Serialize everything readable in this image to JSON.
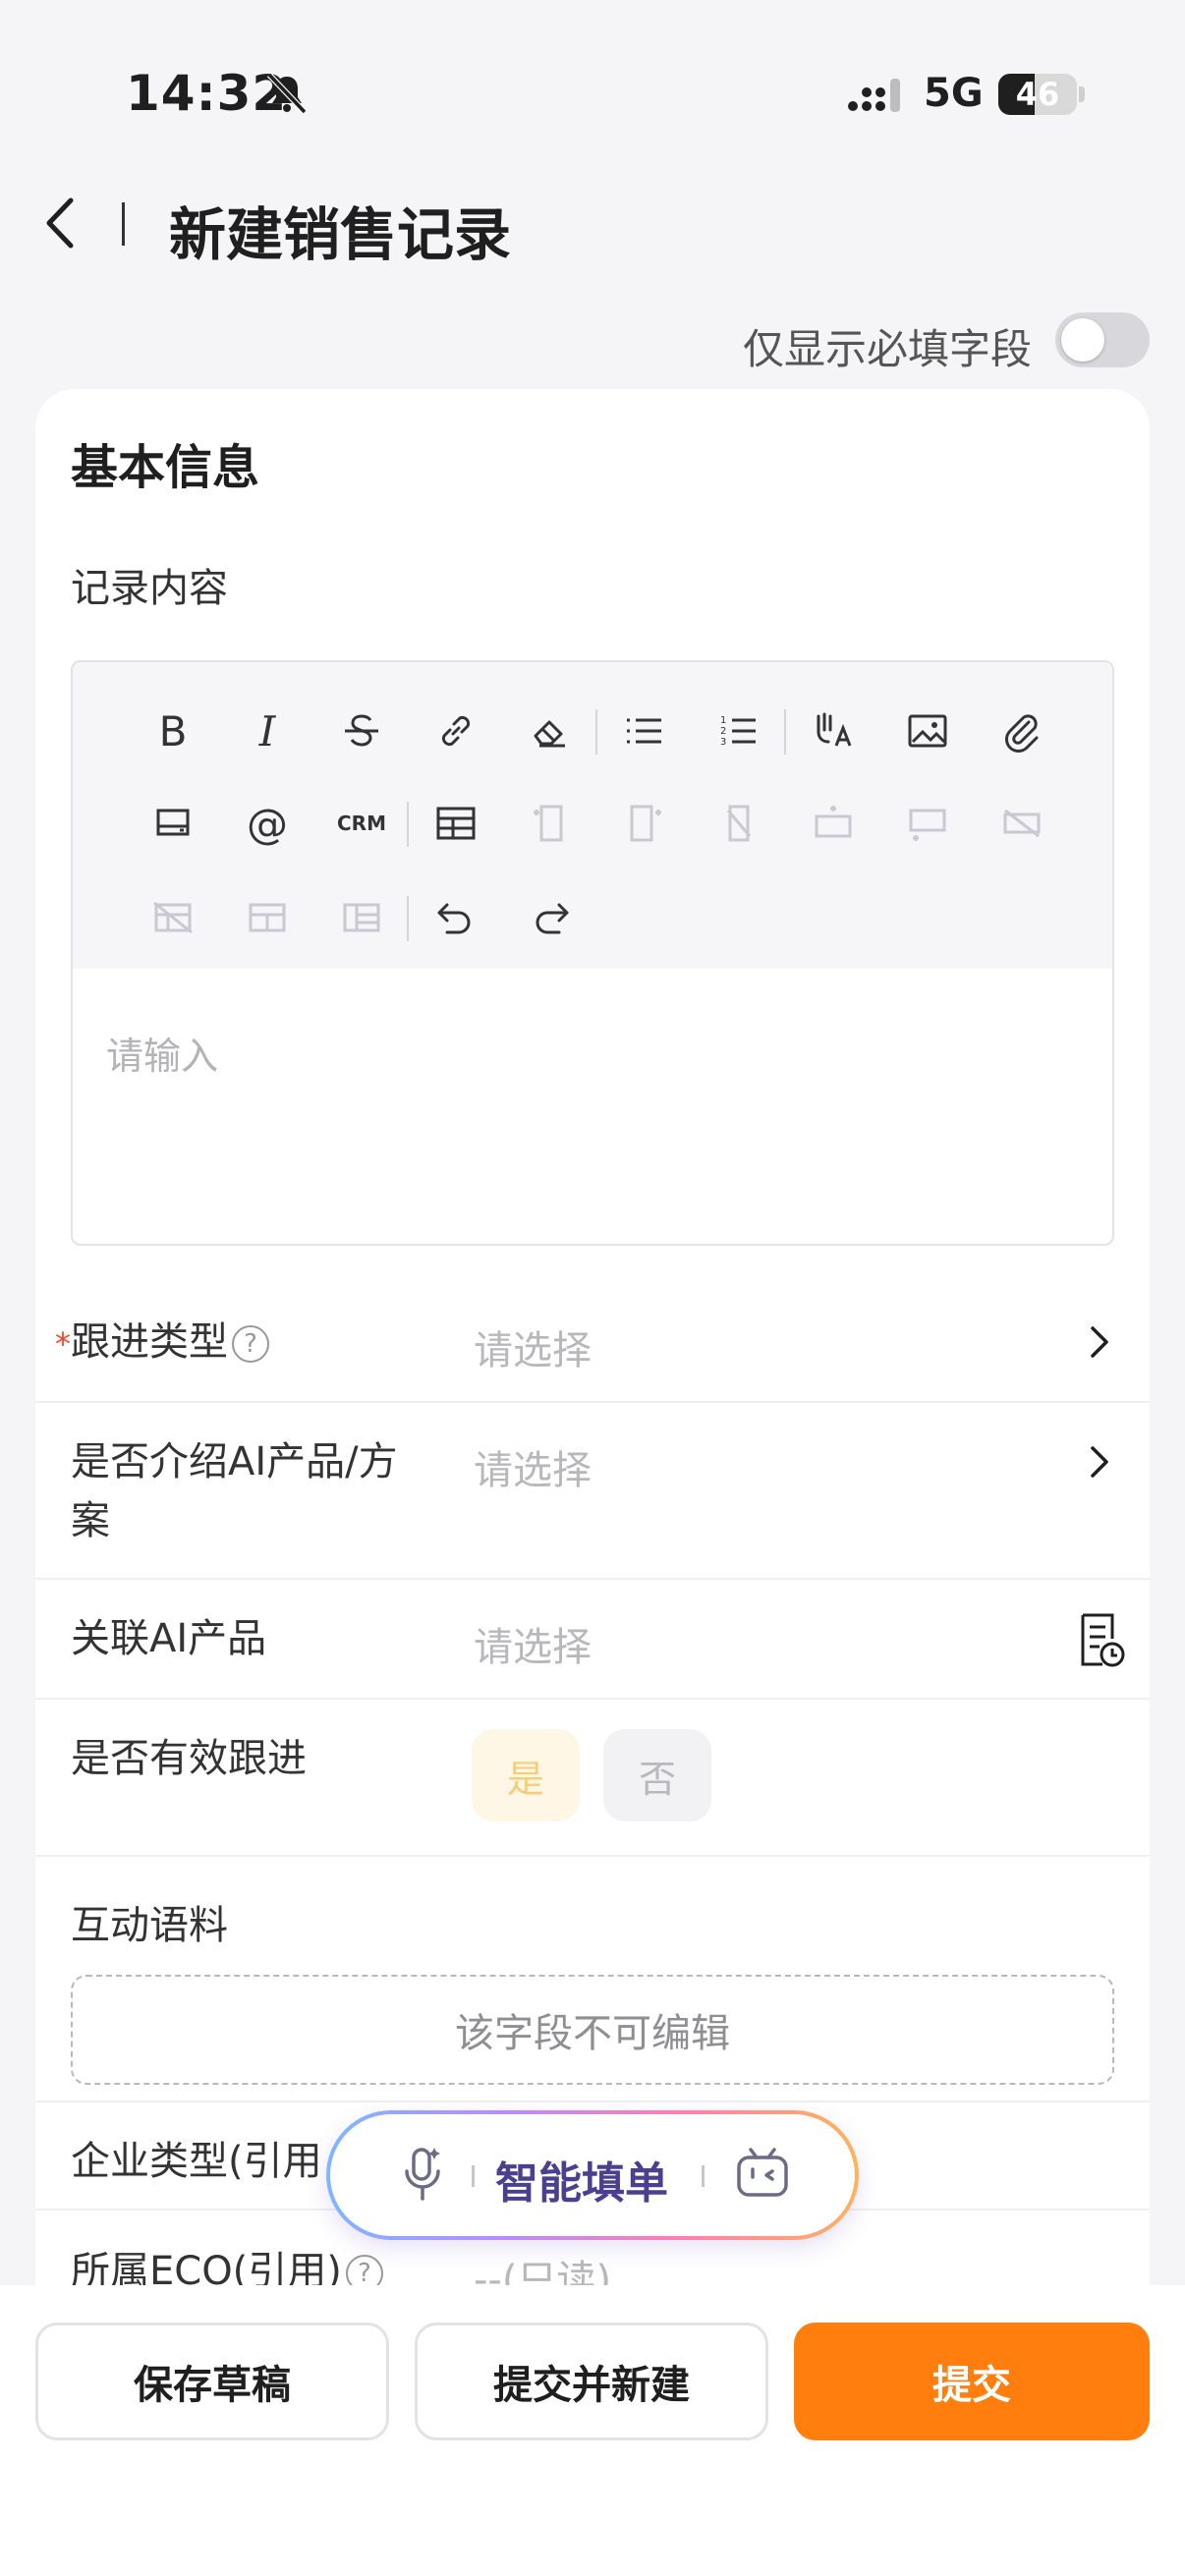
{
  "status_bar": {
    "time": "14:32",
    "network": "5G",
    "battery": "46",
    "battery_level": 0.46
  },
  "header": {
    "title": "新建销售记录"
  },
  "filter": {
    "required_only_label": "仅显示必填字段",
    "required_only_on": false
  },
  "basic_info": {
    "section_title": "基本信息"
  },
  "editor": {
    "label": "记录内容",
    "placeholder": "请输入",
    "toolbar": [
      "bold",
      "italic",
      "strikethrough",
      "link",
      "eraser",
      "bullet-list",
      "numbered-list",
      "format",
      "image",
      "attachment",
      "card",
      "mention",
      "crm",
      "table",
      "insert-col-left",
      "insert-col-right",
      "delete-col",
      "insert-row-above",
      "insert-row-below",
      "delete-row",
      "delete-table",
      "merge-cells",
      "split-cells",
      "undo",
      "redo"
    ],
    "bold_label": "B",
    "italic_label": "I",
    "mention_label": "@",
    "crm_label": "CRM"
  },
  "fields": {
    "follow_type": {
      "label": "跟进类型",
      "required_mark": "*",
      "help": "?",
      "value": "请选择"
    },
    "intro_ai": {
      "label_line1": "是否介绍AI产品/方",
      "label_line2": "案",
      "value": "请选择"
    },
    "related_ai": {
      "label": "关联AI产品",
      "value": "请选择"
    },
    "effective": {
      "label": "是否有效跟进",
      "yes": "是",
      "no": "否"
    },
    "corpus": {
      "label": "互动语料",
      "readonly_text": "该字段不可编辑"
    },
    "company_type": {
      "label": "企业类型(引用"
    },
    "eco": {
      "label": "所属ECO(引用)",
      "help": "?",
      "value": "--(只读)"
    }
  },
  "ai_fill": {
    "label": "智能填单"
  },
  "actions": {
    "save_draft": "保存草稿",
    "submit_new": "提交并新建",
    "submit": "提交"
  },
  "colors": {
    "primary": "#ff7e0e",
    "required": "#f04a2a"
  }
}
